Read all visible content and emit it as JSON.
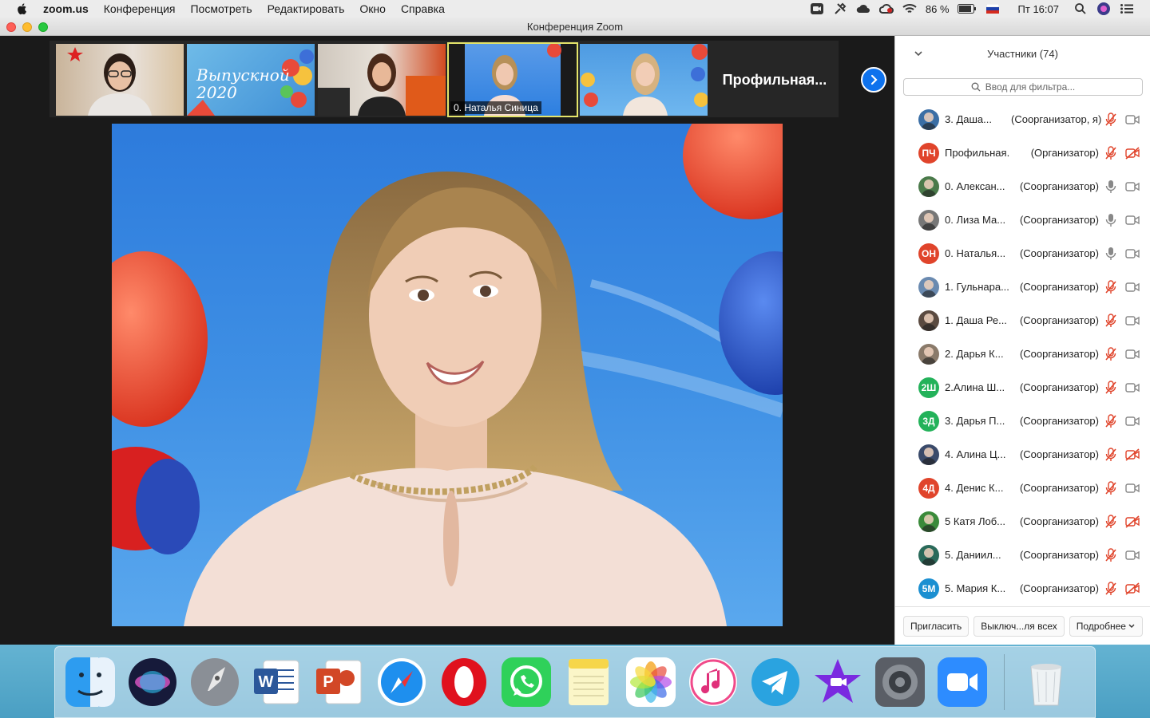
{
  "menubar": {
    "app": "zoom.us",
    "items": [
      "Конференция",
      "Посмотреть",
      "Редактировать",
      "Окно",
      "Справка"
    ],
    "battery": "86 %",
    "clock": "Пт 16:07"
  },
  "window": {
    "title": "Конференция Zoom"
  },
  "strip": {
    "thumbs": [
      {
        "name": ""
      },
      {
        "name": ""
      },
      {
        "name": ""
      },
      {
        "name": "0. Наталья Синица"
      },
      {
        "name": ""
      }
    ],
    "graduation_text": "Выпускной 2020",
    "text_tile": "Профильная..."
  },
  "panel": {
    "title": "Участники (74)",
    "filter_placeholder": "Ввод для фильтра...",
    "participants": [
      {
        "name": "3. Даша...",
        "role": "(Соорганизатор, я)",
        "avatar": "photo",
        "color": "#3a6ea5",
        "mic": "muted",
        "cam": "on"
      },
      {
        "name": "Профильная...",
        "role": "(Организатор)",
        "avatar": "ПЧ",
        "color": "#e0442b",
        "mic": "muted",
        "cam": "off"
      },
      {
        "name": "0. Алексан...",
        "role": "(Соорганизатор)",
        "avatar": "photo",
        "color": "#4a7a4a",
        "mic": "on",
        "cam": "on"
      },
      {
        "name": "0. Лиза Ма...",
        "role": "(Соорганизатор)",
        "avatar": "photo",
        "color": "#777777",
        "mic": "on",
        "cam": "on"
      },
      {
        "name": "0. Наталья...",
        "role": "(Соорганизатор)",
        "avatar": "ОН",
        "color": "#e0442b",
        "mic": "on",
        "cam": "on"
      },
      {
        "name": "1. Гульнара...",
        "role": "(Соорганизатор)",
        "avatar": "photo",
        "color": "#6a8ab0",
        "mic": "muted",
        "cam": "on"
      },
      {
        "name": "1. Даша Ре...",
        "role": "(Соорганизатор)",
        "avatar": "photo",
        "color": "#5a4a40",
        "mic": "muted",
        "cam": "on"
      },
      {
        "name": "2. Дарья К...",
        "role": "(Соорганизатор)",
        "avatar": "photo",
        "color": "#8a7a6a",
        "mic": "muted",
        "cam": "on"
      },
      {
        "name": "2.Алина Ш...",
        "role": "(Соорганизатор)",
        "avatar": "2Ш",
        "color": "#23b25a",
        "mic": "muted",
        "cam": "on"
      },
      {
        "name": "3. Дарья П...",
        "role": "(Соорганизатор)",
        "avatar": "3Д",
        "color": "#23b25a",
        "mic": "muted",
        "cam": "on"
      },
      {
        "name": "4. Алина Ц...",
        "role": "(Соорганизатор)",
        "avatar": "photo",
        "color": "#3a4a6a",
        "mic": "muted",
        "cam": "off"
      },
      {
        "name": "4. Денис К...",
        "role": "(Соорганизатор)",
        "avatar": "4Д",
        "color": "#e0442b",
        "mic": "muted",
        "cam": "on"
      },
      {
        "name": "5 Катя Лоб...",
        "role": "(Соорганизатор)",
        "avatar": "photo",
        "color": "#3a8a3a",
        "mic": "muted",
        "cam": "off"
      },
      {
        "name": "5. Даниил...",
        "role": "(Соорганизатор)",
        "avatar": "photo",
        "color": "#2a6a5a",
        "mic": "muted",
        "cam": "on"
      },
      {
        "name": "5. Мария К...",
        "role": "(Соорганизатор)",
        "avatar": "5М",
        "color": "#1b8fd1",
        "mic": "muted",
        "cam": "off"
      }
    ],
    "footer": {
      "invite": "Пригласить",
      "mute_all": "Выключ...ля всех",
      "more": "Подробнее"
    }
  },
  "dock": {
    "apps": [
      "finder-icon",
      "siri-icon",
      "launchpad-icon",
      "word-icon",
      "powerpoint-icon",
      "safari-icon",
      "opera-icon",
      "whatsapp-icon",
      "notes-icon",
      "photos-icon",
      "music-icon",
      "telegram-icon",
      "imovie-icon",
      "system-preferences-icon",
      "zoom-icon",
      "trash-icon"
    ]
  },
  "colors": {
    "accent": "#0e72ed",
    "muted_red": "#e0442b",
    "active_outline": "#e4e46a"
  }
}
